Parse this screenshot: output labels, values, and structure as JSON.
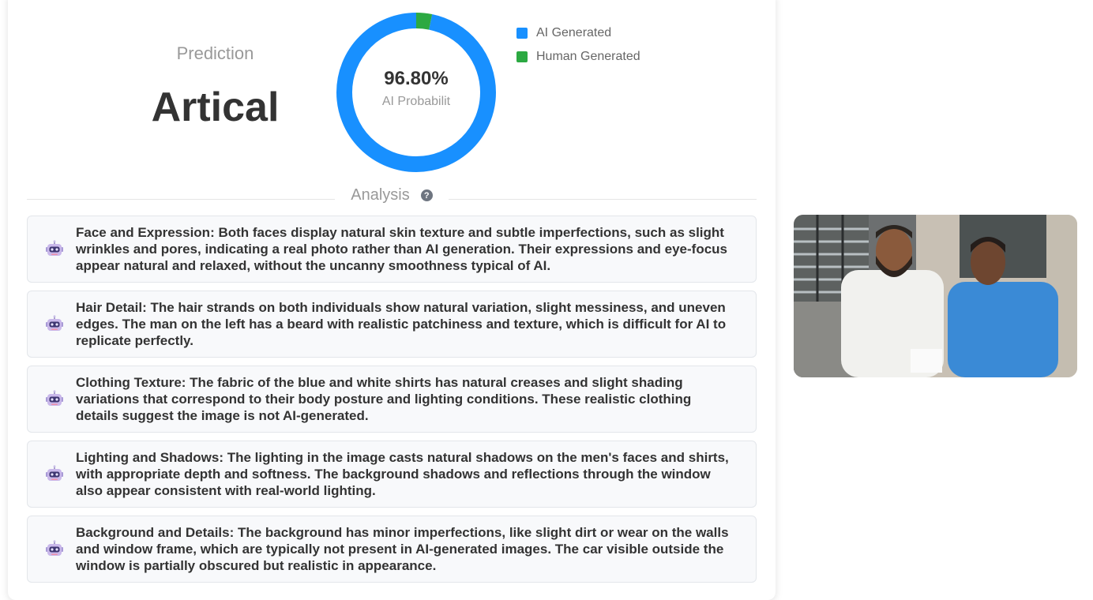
{
  "prediction": {
    "label": "Prediction",
    "value": "Artical"
  },
  "probability": {
    "percent_text": "96.80%",
    "caption": "AI Probabilit",
    "ai_fraction": 0.968,
    "ai_color": "#1890ff",
    "human_color": "#2ca942"
  },
  "legend": {
    "ai": "AI Generated",
    "human": "Human Generated"
  },
  "analysis": {
    "title": "Analysis",
    "items": [
      {
        "text": "Face and Expression: Both faces display natural skin texture and subtle imperfections, such as slight wrinkles and pores, indicating a real photo rather than AI generation. Their expressions and eye-focus appear natural and relaxed, without the uncanny smoothness typical of AI."
      },
      {
        "text": "Hair Detail: The hair strands on both individuals show natural variation, slight messiness, and uneven edges. The man on the left has a beard with realistic patchiness and texture, which is difficult for AI to replicate perfectly."
      },
      {
        "text": "Clothing Texture: The fabric of the blue and white shirts has natural creases and slight shading variations that correspond to their body posture and lighting conditions. These realistic clothing details suggest the image is not AI-generated."
      },
      {
        "text": "Lighting and Shadows: The lighting in the image casts natural shadows on the men's faces and shirts, with appropriate depth and softness. The background shadows and reflections through the window also appear consistent with real-world lighting."
      },
      {
        "text": "Background and Details: The background has minor imperfections, like slight dirt or wear on the walls and window frame, which are typically not present in AI-generated images. The car visible outside the window is partially obscured but realistic in appearance."
      }
    ]
  }
}
